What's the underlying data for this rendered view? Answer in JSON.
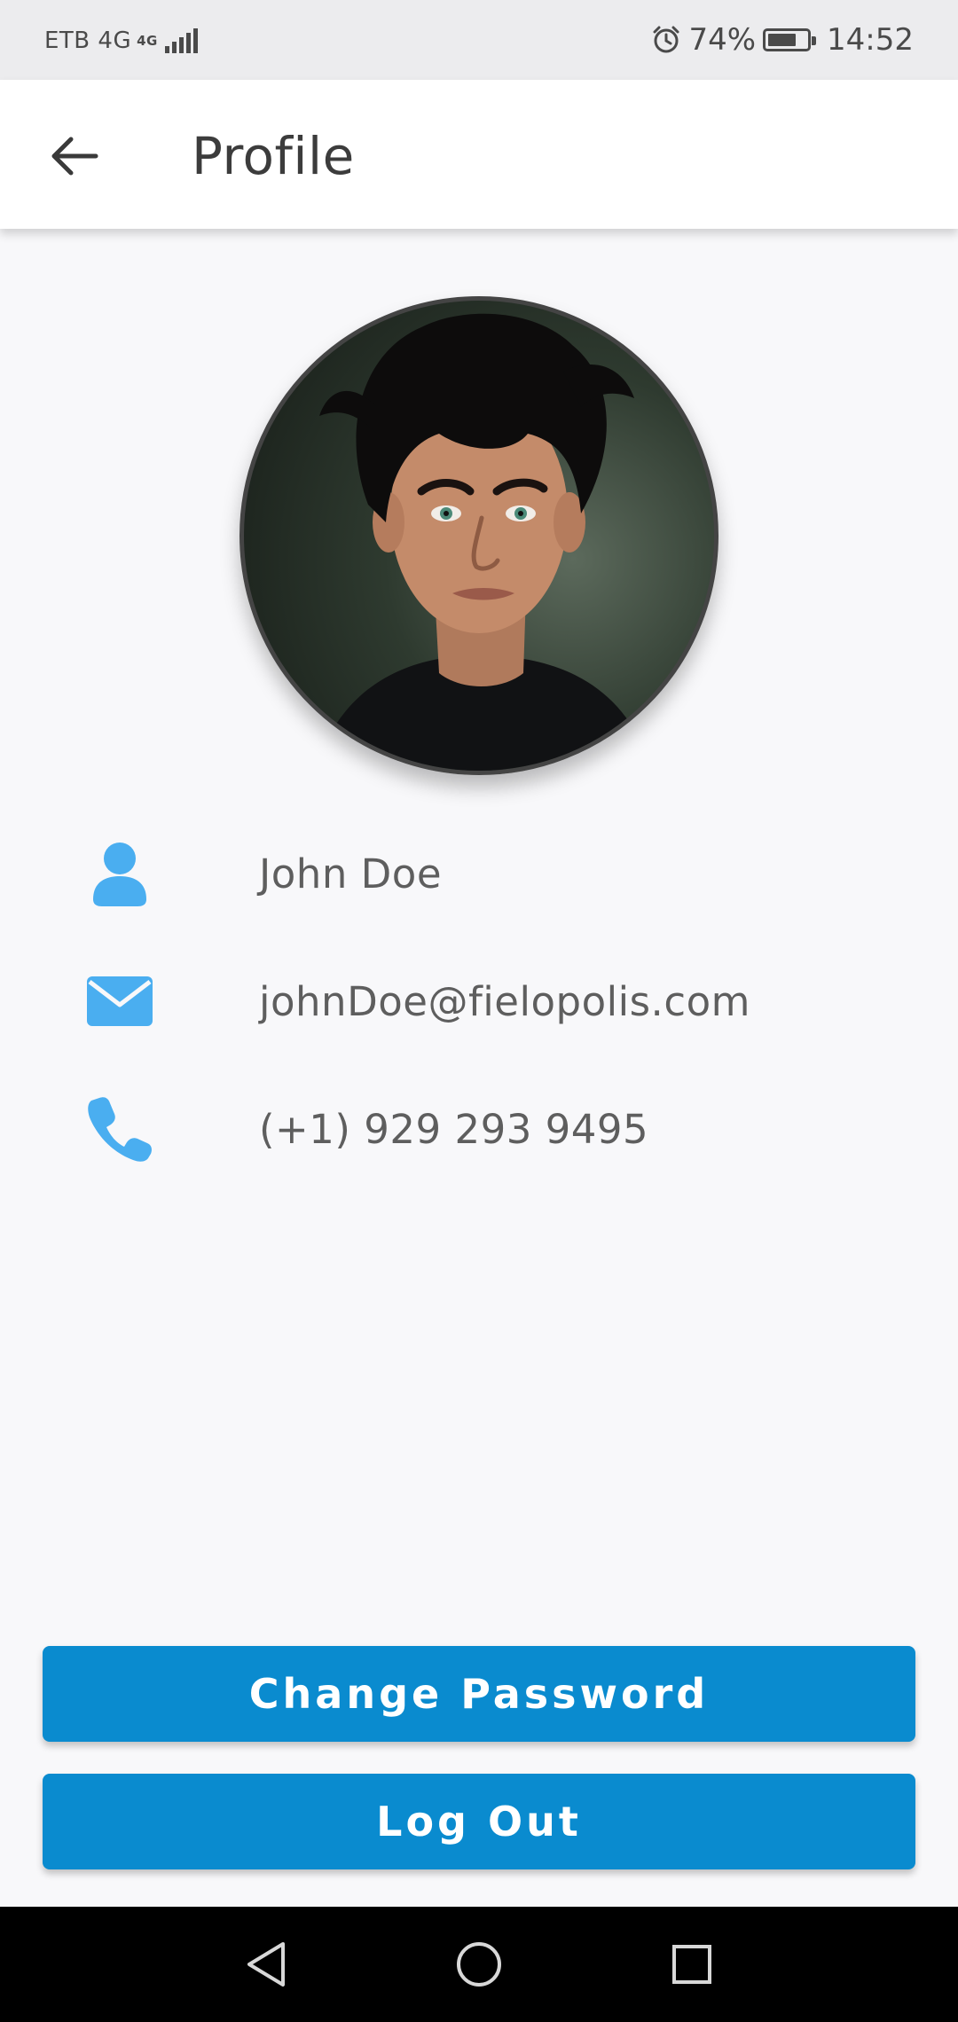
{
  "status_bar": {
    "carrier": "ETB 4G",
    "network_badge": "4G",
    "battery_percent": "74%",
    "battery_level": 0.74,
    "time": "14:52"
  },
  "app_bar": {
    "title": "Profile"
  },
  "profile": {
    "name": "John Doe",
    "email": "johnDoe@fielopolis.com",
    "phone": "(+1) 929 293 9495"
  },
  "actions": {
    "change_password": "Change Password",
    "log_out": "Log Out"
  },
  "colors": {
    "accent": "#0a8bcf",
    "icon": "#4aaef0",
    "text": "#5e5e5e"
  },
  "icons": {
    "back": "arrow-left-icon",
    "name": "person-icon",
    "email": "envelope-icon",
    "phone": "phone-icon",
    "alarm": "alarm-icon",
    "battery": "battery-icon",
    "signal": "signal-icon",
    "nav_back": "triangle-back-icon",
    "nav_home": "circle-home-icon",
    "nav_recents": "square-recents-icon"
  }
}
